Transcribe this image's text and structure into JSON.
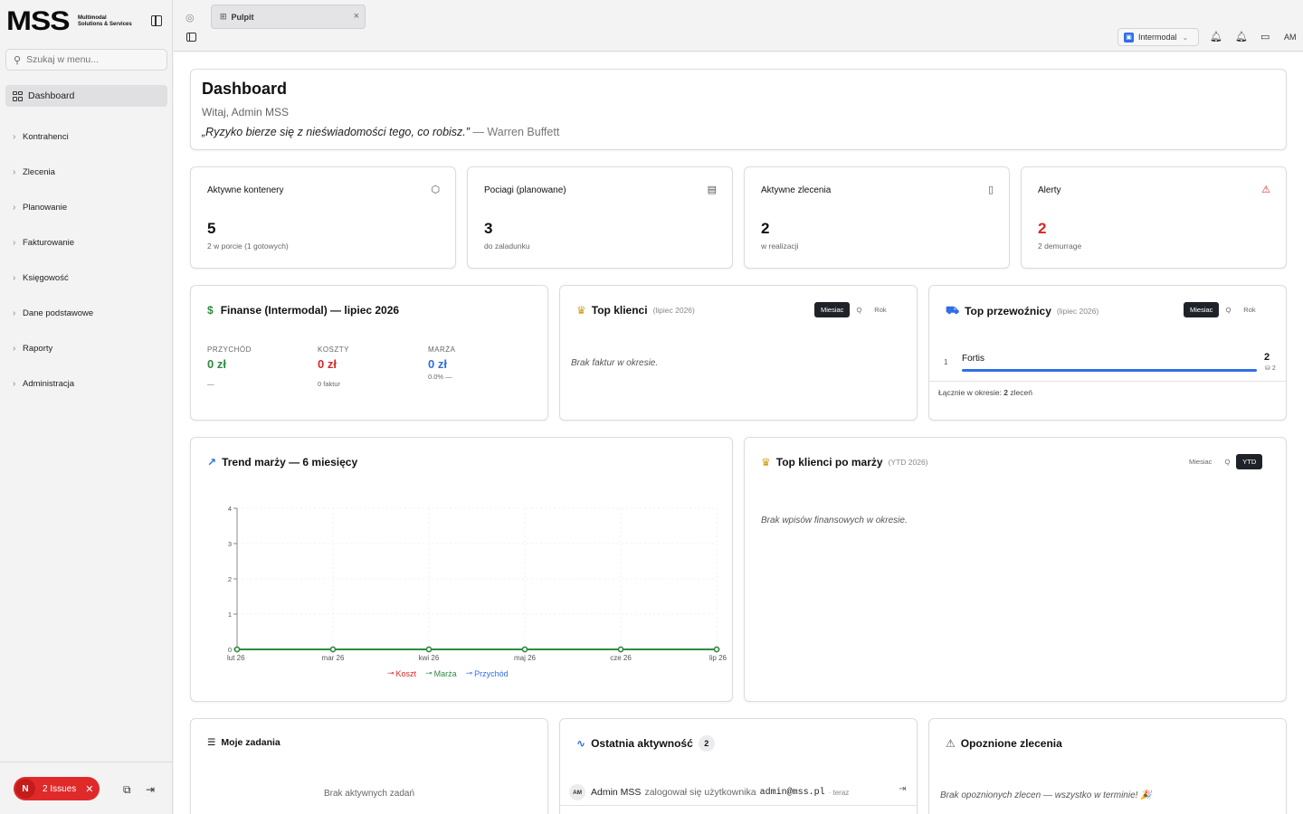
{
  "sidebar": {
    "logo": "MSS",
    "logo_sub_1": "Multimodal",
    "logo_sub_2": "Solutions & Services",
    "search_placeholder": "Szukaj w menu...",
    "active_item": "Dashboard",
    "items": [
      "Kontrahenci",
      "Zlecenia",
      "Planowanie",
      "Fakturowanie",
      "Księgowość",
      "Dane podstawowe",
      "Raporty",
      "Administracja"
    ],
    "issues_badge": "N",
    "issues_label": "2 Issues"
  },
  "topbar": {
    "tab_label": "Pulpit",
    "org_label": "Intermodal",
    "avatar": "AM"
  },
  "welcome": {
    "title": "Dashboard",
    "greeting": "Witaj, Admin MSS",
    "quote": "„Ryzyko bierze się z nieświadomości tego, co robisz.”",
    "author": "— Warren Buffett"
  },
  "stats": [
    {
      "label": "Aktywne kontenery",
      "value": "5",
      "note": "2 w porcie (1 gotowych)"
    },
    {
      "label": "Pociagi (planowane)",
      "value": "3",
      "note": "do zaladunku"
    },
    {
      "label": "Aktywne zlecenia",
      "value": "2",
      "note": "w realizacji"
    },
    {
      "label": "Alerty",
      "value": "2",
      "note": "2 demurrage"
    }
  ],
  "finance": {
    "title": "Finanse (Intermodal) — lipiec 2026",
    "revenue_label": "PRZYCHÓD",
    "revenue_value": "0 zł",
    "revenue_note": "—",
    "cost_label": "KOSZTY",
    "cost_value": "0 zł",
    "cost_note": "0 faktur",
    "margin_label": "MARŻA",
    "margin_value": "0 zł",
    "margin_note": "0.0% —"
  },
  "top_clients": {
    "title": "Top klienci",
    "period": "(lipiec 2026)",
    "seg": [
      "Miesiac",
      "Q",
      "Rok"
    ],
    "empty": "Brak faktur w okresie."
  },
  "top_carriers": {
    "title": "Top przewoźnicy",
    "period": "(lipiec 2026)",
    "seg": [
      "Miesiac",
      "Q",
      "Rok"
    ],
    "rank": "1",
    "name": "Fortis",
    "count": "2",
    "count_sub": "2",
    "total_label": "Łącznie w okresie:",
    "total_value": "2",
    "total_unit": "zleceń"
  },
  "trend": {
    "title": "Trend marży — 6 miesięcy"
  },
  "chart_data": {
    "type": "line",
    "title": "Trend marży — 6 miesięcy",
    "x": [
      "lut 26",
      "mar 26",
      "kwi 26",
      "maj 26",
      "cze 26",
      "lip 26"
    ],
    "series": [
      {
        "name": "Koszt",
        "values": [
          0,
          0,
          0,
          0,
          0,
          0
        ],
        "color": "#d92626"
      },
      {
        "name": "Marża",
        "values": [
          0,
          0,
          0,
          0,
          0,
          0
        ],
        "color": "#2e8b3e"
      },
      {
        "name": "Przychód",
        "values": [
          0,
          0,
          0,
          0,
          0,
          0
        ],
        "color": "#2f6ee6"
      }
    ],
    "yticks": [
      "0",
      "1",
      "2",
      "3",
      "4"
    ],
    "ylim": [
      0,
      4
    ],
    "grid": true,
    "legend": "bottom"
  },
  "top_margin": {
    "title": "Top klienci po marży",
    "period": "(YTD 2026)",
    "seg": [
      "Miesiac",
      "Q",
      "YTD"
    ],
    "empty": "Brak wpisów finansowych w okresie."
  },
  "tasks": {
    "title": "Moje zadania",
    "empty": "Brak aktywnych zadań"
  },
  "activity": {
    "title": "Ostatnia aktywność",
    "count": "2",
    "avatar": "AM",
    "user": "Admin MSS",
    "action": "zalogował się użytkownika",
    "email": "admin@mss.pl",
    "time": "· teraz"
  },
  "delayed": {
    "title": "Opoznione zlecenia",
    "empty": "Brak opoznionych zlecen — wszystko w terminie! 🎉"
  },
  "colors": {
    "accent_blue": "#2f6ee6",
    "danger": "#d92626",
    "success": "#2e8b3e",
    "dark": "#1f2329"
  }
}
